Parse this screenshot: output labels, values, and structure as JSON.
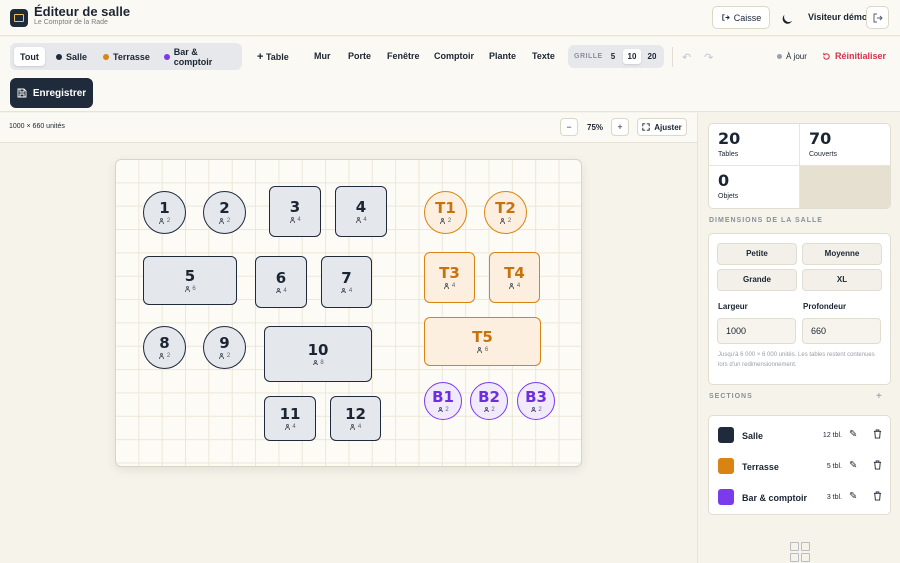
{
  "header": {
    "title": "Éditeur de salle",
    "subtitle": "Le Comptoir de la Rade",
    "caisse_label": "Caisse",
    "visitor_label": "Visiteur démo"
  },
  "toolbar": {
    "filters": {
      "all": "Tout",
      "salle": "Salle",
      "terrasse": "Terrasse",
      "bar": "Bar & comptoir"
    },
    "tools": {
      "table": "Table",
      "mur": "Mur",
      "porte": "Porte",
      "fenetre": "Fenêtre",
      "comptoir": "Comptoir",
      "plante": "Plante",
      "texte": "Texte"
    },
    "grid": {
      "label": "GRILLE",
      "opt1": "5",
      "opt2": "10",
      "opt3": "20",
      "selected": "10"
    },
    "sync_label": "À jour",
    "reset_label": "Réinitialiser",
    "save_label": "Enregistrer"
  },
  "canvas": {
    "dimensions_label": "1000 × 660 unités",
    "zoom_out": "−",
    "zoom_value": "75%",
    "zoom_in": "+",
    "fit_label": "Ajuster"
  },
  "colors": {
    "salle": "#1f2a3a",
    "terrasse": "#d98412",
    "bar": "#7c3aed",
    "danger": "#d6334a"
  },
  "tables": [
    {
      "num": "1",
      "seats": "2"
    },
    {
      "num": "2",
      "seats": "2"
    },
    {
      "num": "3",
      "seats": "4"
    },
    {
      "num": "4",
      "seats": "4"
    },
    {
      "num": "5",
      "seats": "6"
    },
    {
      "num": "6",
      "seats": "4"
    },
    {
      "num": "7",
      "seats": "4"
    },
    {
      "num": "8",
      "seats": "2"
    },
    {
      "num": "9",
      "seats": "2"
    },
    {
      "num": "10",
      "seats": "8"
    },
    {
      "num": "11",
      "seats": "4"
    },
    {
      "num": "12",
      "seats": "4"
    },
    {
      "num": "T1",
      "seats": "2"
    },
    {
      "num": "T2",
      "seats": "2"
    },
    {
      "num": "T3",
      "seats": "4"
    },
    {
      "num": "T4",
      "seats": "4"
    },
    {
      "num": "T5",
      "seats": "6"
    },
    {
      "num": "B1",
      "seats": "2"
    },
    {
      "num": "B2",
      "seats": "2"
    },
    {
      "num": "B3",
      "seats": "2"
    }
  ],
  "panel": {
    "stats": {
      "tables_value": "20",
      "tables_label": "Tables",
      "covers_value": "70",
      "covers_label": "Couverts",
      "objects_value": "0",
      "objects_label": "Objets"
    },
    "dimensions": {
      "title": "DIMENSIONS DE LA SALLE",
      "petite": "Petite",
      "moyenne": "Moyenne",
      "grande": "Grande",
      "xl": "XL",
      "width_label": "Largeur",
      "width_value": "1000",
      "depth_label": "Profondeur",
      "depth_value": "660",
      "hint": "Jusqu'à 6 000 × 6 000 unités. Les tables restent contenues lors d'un redimensionnement."
    },
    "sections": {
      "title": "SECTIONS",
      "items": [
        {
          "name": "Salle",
          "count": "12 tbl."
        },
        {
          "name": "Terrasse",
          "count": "5 tbl."
        },
        {
          "name": "Bar & comptoir",
          "count": "3 tbl."
        }
      ]
    }
  }
}
